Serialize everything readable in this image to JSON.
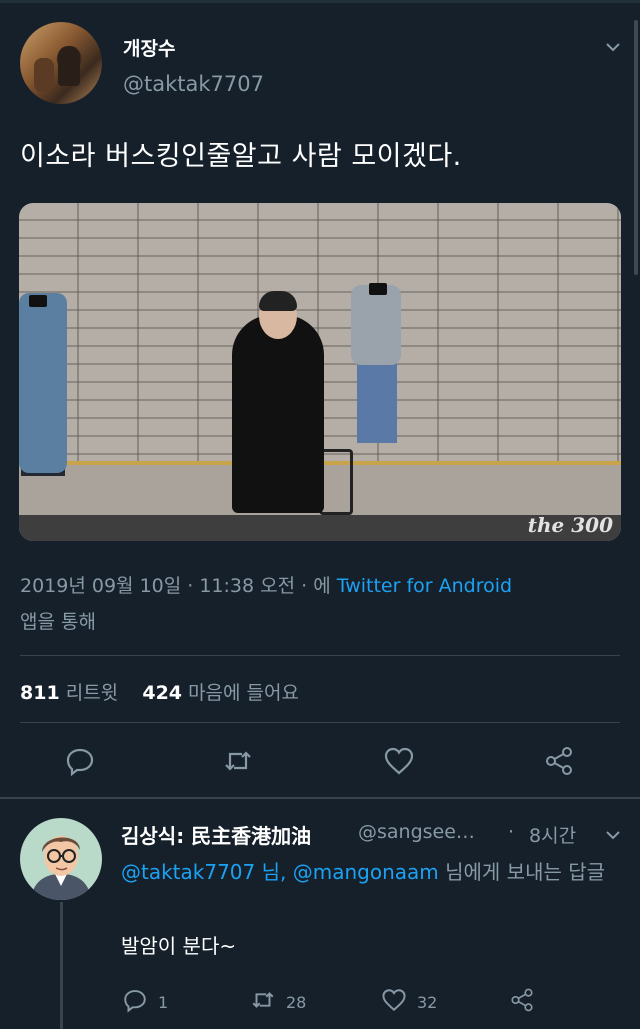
{
  "colors": {
    "background": "#15202b",
    "text": "#ffffff",
    "secondary": "#8899a6",
    "link": "#1da1f2",
    "divider": "#38444d"
  },
  "tweet": {
    "display_name": "개장수",
    "handle": "@taktak7707",
    "text": "이소라 버스킹인줄알고 사람 모이겠다.",
    "media_watermark": "the 300",
    "date_time": "2019년 09월 10일 · 11:38 오전 · 에 ",
    "source": "Twitter for Android",
    "via_suffix": "앱을 통해",
    "retweet_count": "811",
    "retweet_label": "리트윗",
    "like_count": "424",
    "like_label": "마음에 들어요",
    "icons": [
      "chevron-down-icon",
      "reply-icon",
      "retweet-icon",
      "like-icon",
      "share-icon"
    ]
  },
  "reply": {
    "display_name": "김상식: 民主香港加油",
    "handle": "@sangsee…",
    "dot": "·",
    "time": "8시간",
    "mention1": "@taktak7707",
    "mention_joiner": " 님, ",
    "mention2": "@mangonaam",
    "reply_to_suffix": " 님에게 보내는 답글",
    "text": "발암이 분다~",
    "reply_count": "1",
    "retweet_count": "28",
    "like_count": "32"
  }
}
